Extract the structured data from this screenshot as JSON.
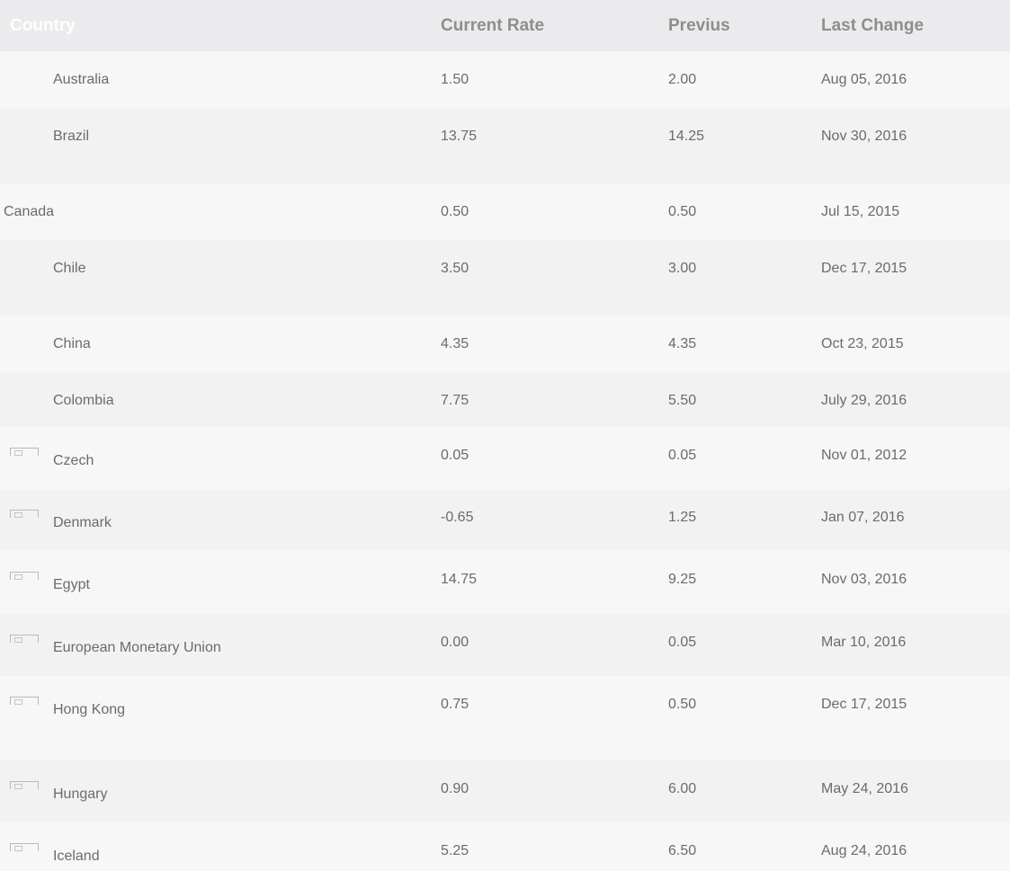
{
  "table": {
    "headers": {
      "country": "Country",
      "current": "Current Rate",
      "previous": "Previus",
      "last_change": "Last Change"
    },
    "rows": [
      {
        "country": "Australia",
        "current": "1.50",
        "previous": "2.00",
        "last_change": "Aug 05, 2016"
      },
      {
        "country": "Brazil",
        "current": "13.75",
        "previous": "14.25",
        "last_change": "Nov 30, 2016"
      },
      {
        "country": "Canada",
        "current": "0.50",
        "previous": "0.50",
        "last_change": "Jul 15, 2015"
      },
      {
        "country": "Chile",
        "current": "3.50",
        "previous": "3.00",
        "last_change": "Dec 17, 2015"
      },
      {
        "country": "China",
        "current": "4.35",
        "previous": "4.35",
        "last_change": "Oct 23, 2015"
      },
      {
        "country": "Colombia",
        "current": "7.75",
        "previous": "5.50",
        "last_change": "July 29, 2016"
      },
      {
        "country": "Czech",
        "current": "0.05",
        "previous": "0.05",
        "last_change": "Nov 01, 2012"
      },
      {
        "country": "Denmark",
        "current": "-0.65",
        "previous": "1.25",
        "last_change": "Jan 07, 2016"
      },
      {
        "country": "Egypt",
        "current": "14.75",
        "previous": "9.25",
        "last_change": "Nov 03, 2016"
      },
      {
        "country": "European Monetary Union",
        "current": "0.00",
        "previous": "0.05",
        "last_change": "Mar 10, 2016"
      },
      {
        "country": "Hong Kong",
        "current": "0.75",
        "previous": "0.50",
        "last_change": "Dec 17, 2015"
      },
      {
        "country": "Hungary",
        "current": "0.90",
        "previous": "6.00",
        "last_change": "May 24, 2016"
      },
      {
        "country": "Iceland",
        "current": "5.25",
        "previous": "6.50",
        "last_change": "Aug 24, 2016"
      }
    ]
  },
  "icons": {
    "flag": "broken-image-flag-icon"
  }
}
